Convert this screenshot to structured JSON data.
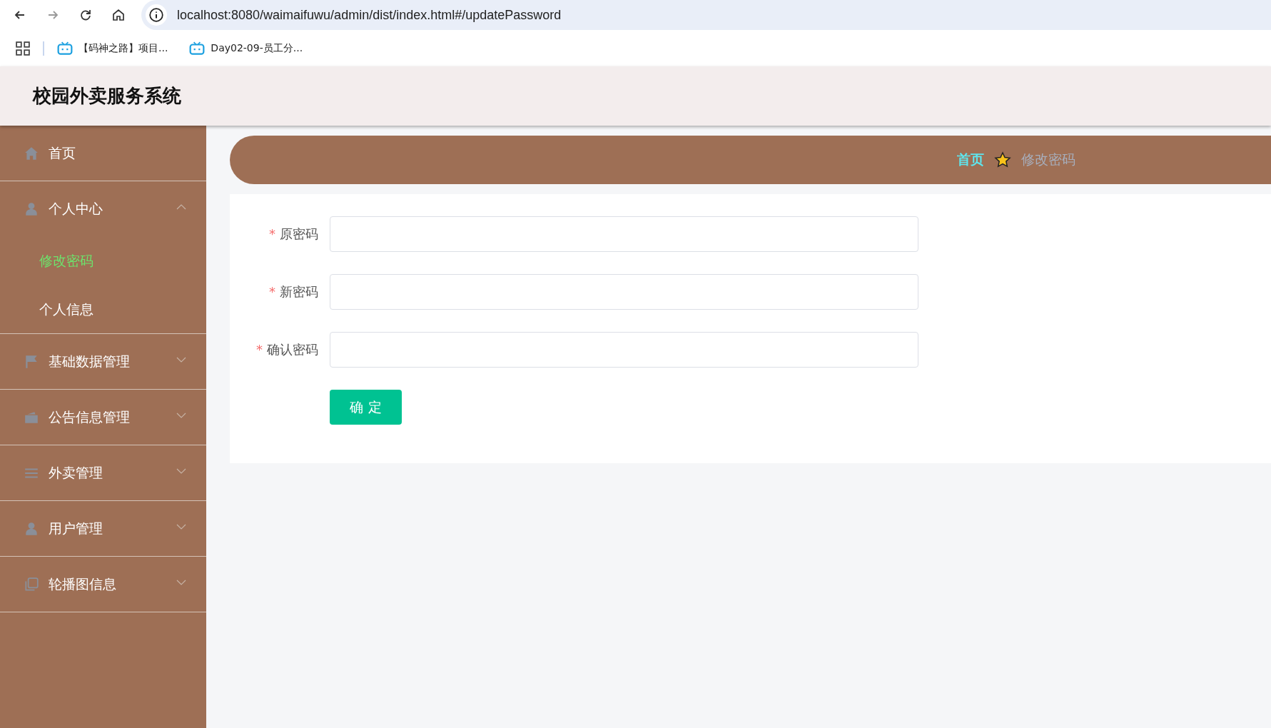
{
  "browser": {
    "url": "localhost:8080/waimaifuwu/admin/dist/index.html#/updatePassword",
    "bookmarks": [
      "【码神之路】项目...",
      "Day02-09-员工分..."
    ]
  },
  "header": {
    "title": "校园外卖服务系统"
  },
  "sidebar": {
    "items": [
      {
        "label": "首页"
      },
      {
        "label": "个人中心",
        "expanded": true,
        "children": [
          {
            "label": "修改密码",
            "selected": true
          },
          {
            "label": "个人信息",
            "selected": false
          }
        ]
      },
      {
        "label": "基础数据管理",
        "expanded": false
      },
      {
        "label": "公告信息管理",
        "expanded": false
      },
      {
        "label": "外卖管理",
        "expanded": false
      },
      {
        "label": "用户管理",
        "expanded": false
      },
      {
        "label": "轮播图信息",
        "expanded": false
      }
    ]
  },
  "breadcrumb": {
    "home": "首页",
    "current": "修改密码"
  },
  "form": {
    "fields": [
      {
        "label": "原密码",
        "required": true
      },
      {
        "label": "新密码",
        "required": true
      },
      {
        "label": "确认密码",
        "required": true
      }
    ],
    "required_mark": "*",
    "submit": "确 定"
  }
}
